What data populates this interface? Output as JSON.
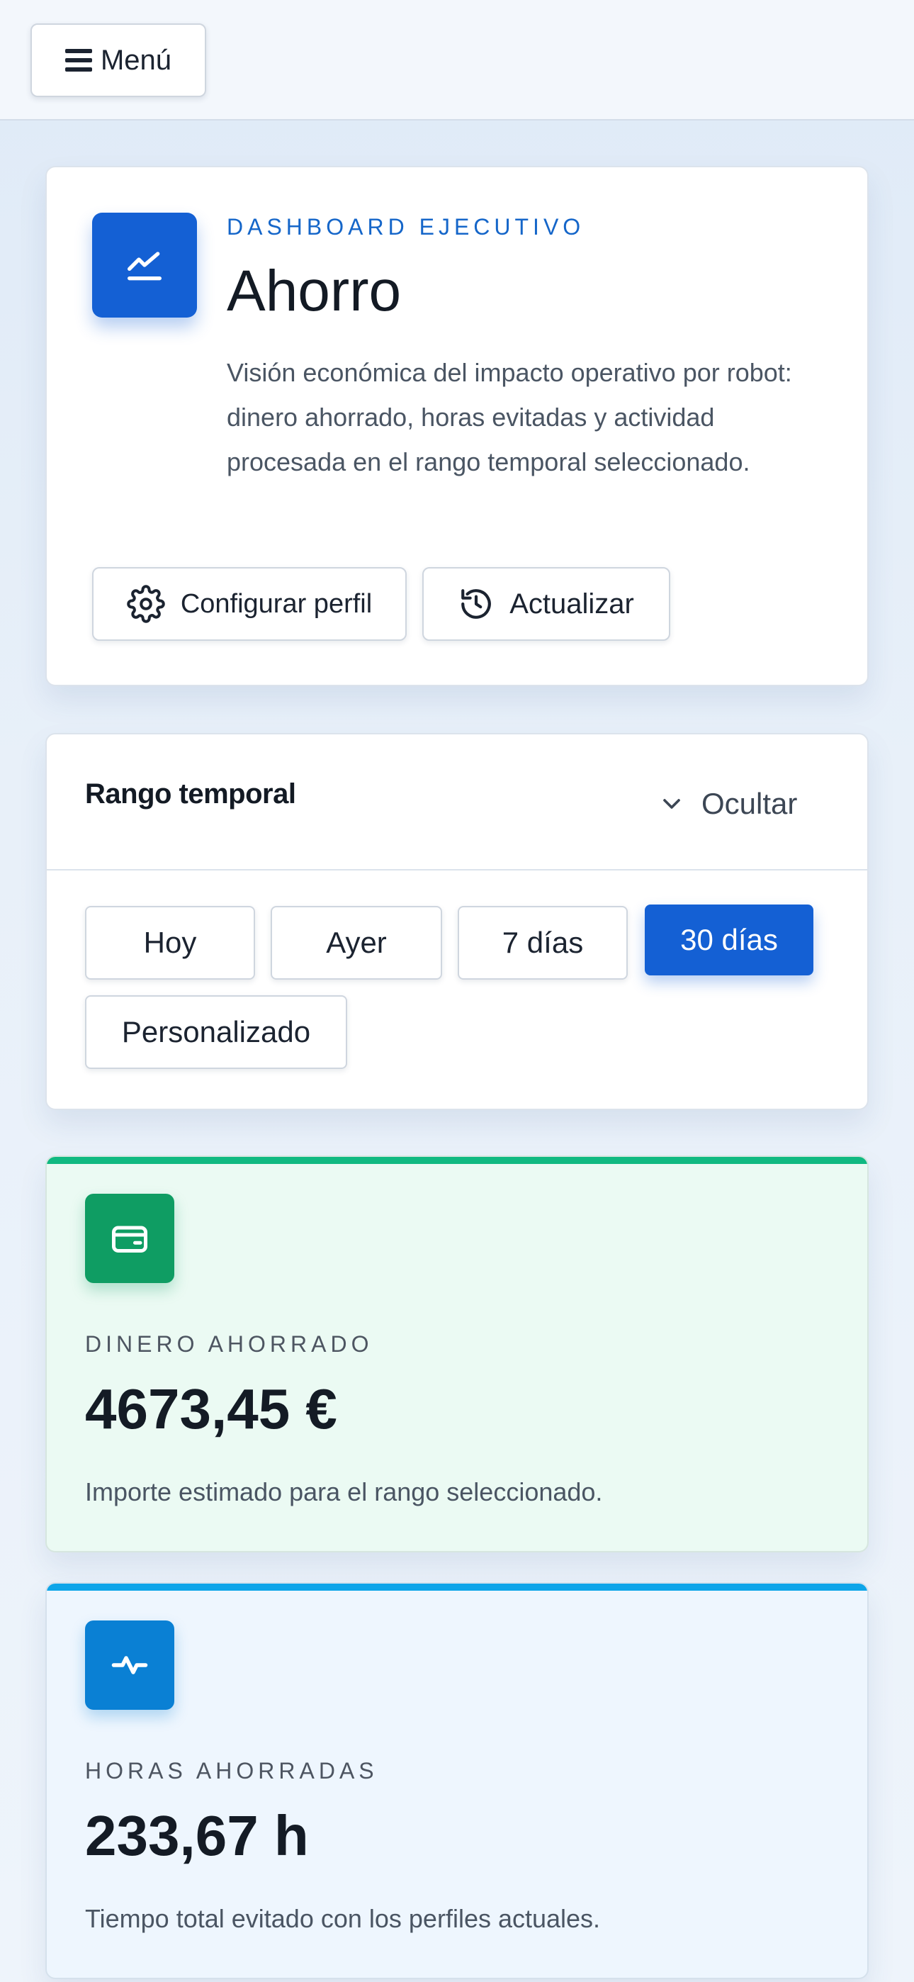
{
  "menu": {
    "label": "Menú",
    "icon": "hamburger-icon"
  },
  "hero": {
    "icon": "trend-chart-icon",
    "eyebrow": "DASHBOARD EJECUTIVO",
    "title": "Ahorro",
    "description": "Visión económica del impacto operativo por robot: dinero ahorrado, horas evitadas y actividad procesada en el rango temporal seleccionado.",
    "configure_label": "Configurar perfil",
    "refresh_label": "Actualizar"
  },
  "range": {
    "title": "Rango temporal",
    "toggle_label": "Ocultar",
    "options": [
      "Hoy",
      "Ayer",
      "7 días",
      "30 días",
      "Personalizado"
    ],
    "selected": "30 días"
  },
  "kpis": [
    {
      "icon": "wallet-icon",
      "label": "DINERO AHORRADO",
      "value": "4673,45 €",
      "note": "Importe estimado para el rango seleccionado.",
      "accent": "#10b981",
      "icon_bg": "#0f9d63"
    },
    {
      "icon": "activity-pulse-icon",
      "label": "HORAS AHORRADAS",
      "value": "233,67 h",
      "note": "Tiempo total evitado con los perfiles actuales.",
      "accent": "#0ea5e9",
      "icon_bg": "#0a80d4"
    }
  ],
  "colors": {
    "primary": "#1460d4",
    "money_accent": "#10b981",
    "hours_accent": "#0ea5e9"
  }
}
